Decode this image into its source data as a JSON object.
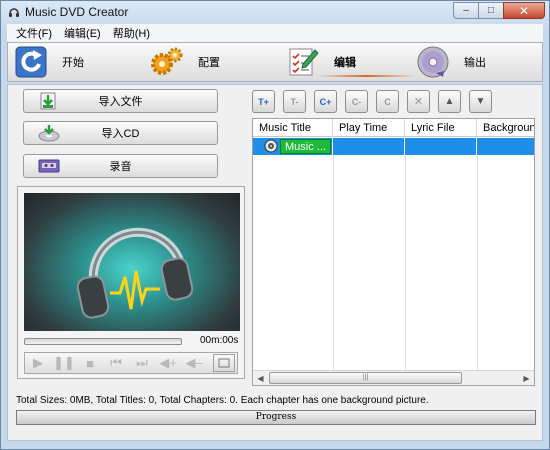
{
  "window": {
    "title": "Music DVD Creator"
  },
  "menu": [
    "文件(F)",
    "编辑(E)",
    "帮助(H)"
  ],
  "steps": [
    {
      "label": "开始",
      "icon": "refresh-arrow-icon"
    },
    {
      "label": "配置",
      "icon": "gears-icon"
    },
    {
      "label": "编辑",
      "icon": "checklist-pencil-icon",
      "active": true
    },
    {
      "label": "输出",
      "icon": "disc-icon"
    }
  ],
  "left_buttons": {
    "import_file": "导入文件",
    "import_cd": "导入CD",
    "record": "录音"
  },
  "player": {
    "time": "00m:00s"
  },
  "toolbar_icons": [
    "add-title-icon",
    "remove-title-icon",
    "add-chapter-icon",
    "remove-chapter-icon",
    "chapter-settings-icon",
    "delete-icon",
    "move-up-icon",
    "move-down-icon"
  ],
  "toolbar_labels": [
    "T+",
    "T-",
    "C+",
    "C-",
    "C",
    "✕",
    "▲",
    "▼"
  ],
  "grid": {
    "columns": [
      "Music Title",
      "Play Time",
      "Lyric File",
      "Background"
    ],
    "rows": [
      {
        "title": "Music ...",
        "play_time": "",
        "lyric_file": "",
        "background": ""
      }
    ]
  },
  "status": "Total Sizes: 0MB, Total Titles: 0, Total Chapters: 0. Each chapter has one background picture.",
  "progress_label": "Progress",
  "colors": {
    "selection": "#1f8ee8",
    "music_pill": "#1cbb3a",
    "active_accent": "#d96a28"
  }
}
